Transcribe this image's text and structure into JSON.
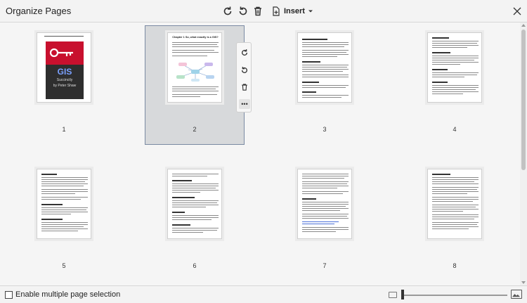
{
  "window": {
    "title": "Organize Pages"
  },
  "toolbar": {
    "insert_label": "Insert"
  },
  "pages": [
    {
      "number": "1",
      "selected": false
    },
    {
      "number": "2",
      "selected": true
    },
    {
      "number": "3",
      "selected": false
    },
    {
      "number": "4",
      "selected": false
    },
    {
      "number": "5",
      "selected": false
    },
    {
      "number": "6",
      "selected": false
    },
    {
      "number": "7",
      "selected": false
    },
    {
      "number": "8",
      "selected": false
    }
  ],
  "cover": {
    "title": "GIS",
    "subtitle": "Succinctly",
    "author": "by Peter Shaw"
  },
  "page2": {
    "heading": "Chapter 1 So, what exactly is a GIS?"
  },
  "footer": {
    "multi_select_label": "Enable multiple page selection"
  },
  "colors": {
    "accent_selection": "#7a8aa3",
    "cover_red": "#c8102e",
    "cover_dark": "#2e2e2e"
  }
}
